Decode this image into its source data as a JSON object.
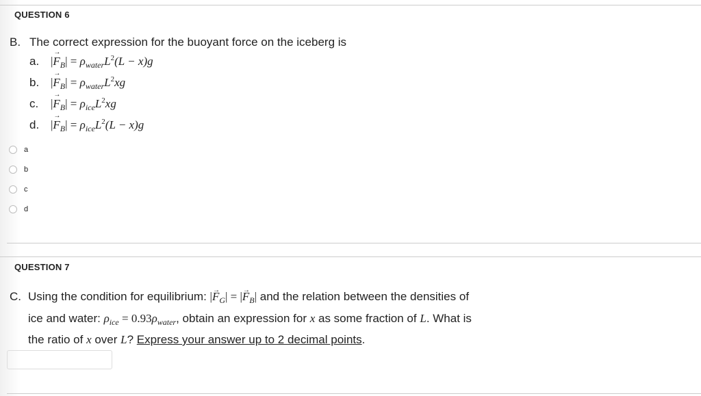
{
  "question6": {
    "title": "QUESTION 6",
    "prompt_letter": "B.",
    "prompt_text": "The correct expression for the buoyant force on the iceberg is",
    "options": [
      {
        "label": "a.",
        "lhs": "F",
        "lhs_sub": "B",
        "eq": "=",
        "rho": "ρ",
        "rho_sub": "water",
        "L": "L",
        "sup": "2",
        "tail": "(L − x)g"
      },
      {
        "label": "b.",
        "lhs": "F",
        "lhs_sub": "B",
        "eq": "=",
        "rho": "ρ",
        "rho_sub": "water",
        "L": "L",
        "sup": "2",
        "tail": "xg"
      },
      {
        "label": "c.",
        "lhs": "F",
        "lhs_sub": "B",
        "eq": "=",
        "rho": "ρ",
        "rho_sub": "ice",
        "L": "L",
        "sup": "2",
        "tail": "xg"
      },
      {
        "label": "d.",
        "lhs": "F",
        "lhs_sub": "B",
        "eq": "=",
        "rho": "ρ",
        "rho_sub": "ice",
        "L": "L",
        "sup": "2",
        "tail": "(L − x)g"
      }
    ],
    "choices": [
      "a",
      "b",
      "c",
      "d"
    ],
    "selected": null
  },
  "question7": {
    "title": "QUESTION 7",
    "prompt_letter": "C.",
    "line1_a": "Using the condition for equilibrium: ",
    "fg": "F",
    "fg_sub": "G",
    "eq": "=",
    "fb": "F",
    "fb_sub": "B",
    "line1_b": " and the relation between the densities of",
    "line2_a": "ice and water: ",
    "rho": "ρ",
    "rho_ice_sub": "ice",
    "relation": " = 0.93",
    "rho_water_sub": "water",
    "line2_b": ", obtain an expression for ",
    "x": "x",
    "line2_c": " as some fraction of ",
    "L": "L",
    "line2_d": ". What is",
    "line3_a": "the ratio of ",
    "line3_b": " over ",
    "line3_c": "? ",
    "line3_underlined": "Express your answer up to 2 decimal points",
    "line3_end": ".",
    "answer_value": "",
    "answer_placeholder": ""
  }
}
